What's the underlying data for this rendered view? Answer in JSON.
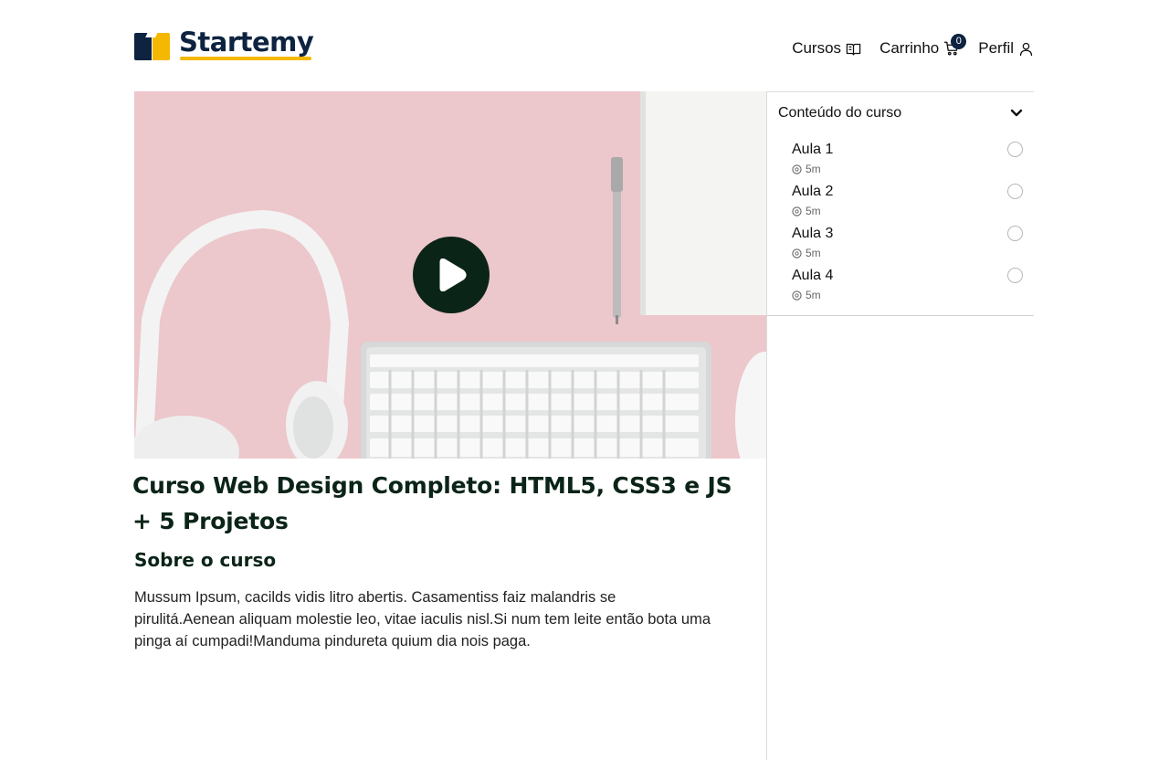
{
  "brand": {
    "name": "Startemy",
    "colors": {
      "navy": "#0d2340",
      "yellow": "#f5b800",
      "title": "#0b2418"
    }
  },
  "nav": {
    "courses": {
      "label": "Cursos",
      "icon": "book-open-icon"
    },
    "cart": {
      "label": "Carrinho",
      "icon": "cart-icon",
      "count": "0"
    },
    "profile": {
      "label": "Perfil",
      "icon": "user-icon"
    }
  },
  "video": {
    "thumbnail": "desk-headphones-keyboard-photo",
    "play_icon": "play-icon"
  },
  "course": {
    "title": "Curso Web Design Completo: HTML5, CSS3 e JS + 5 Projetos",
    "about_heading": "Sobre o curso",
    "about_text": "Mussum Ipsum, cacilds vidis litro abertis. Casamentiss faiz malandris se pirulitá.Aenean aliquam molestie leo, vitae iaculis nisl.Si num tem leite então bota uma pinga aí cumpadi!Manduma pindureta quium dia nois paga."
  },
  "sidebar": {
    "heading": "Conteúdo do curso",
    "toggle_icon": "chevron-down-icon",
    "lessons": [
      {
        "title": "Aula 1",
        "duration": "5m",
        "completed": false
      },
      {
        "title": "Aula 2",
        "duration": "5m",
        "completed": false
      },
      {
        "title": "Aula 3",
        "duration": "5m",
        "completed": false
      },
      {
        "title": "Aula 4",
        "duration": "5m",
        "completed": false
      }
    ]
  }
}
